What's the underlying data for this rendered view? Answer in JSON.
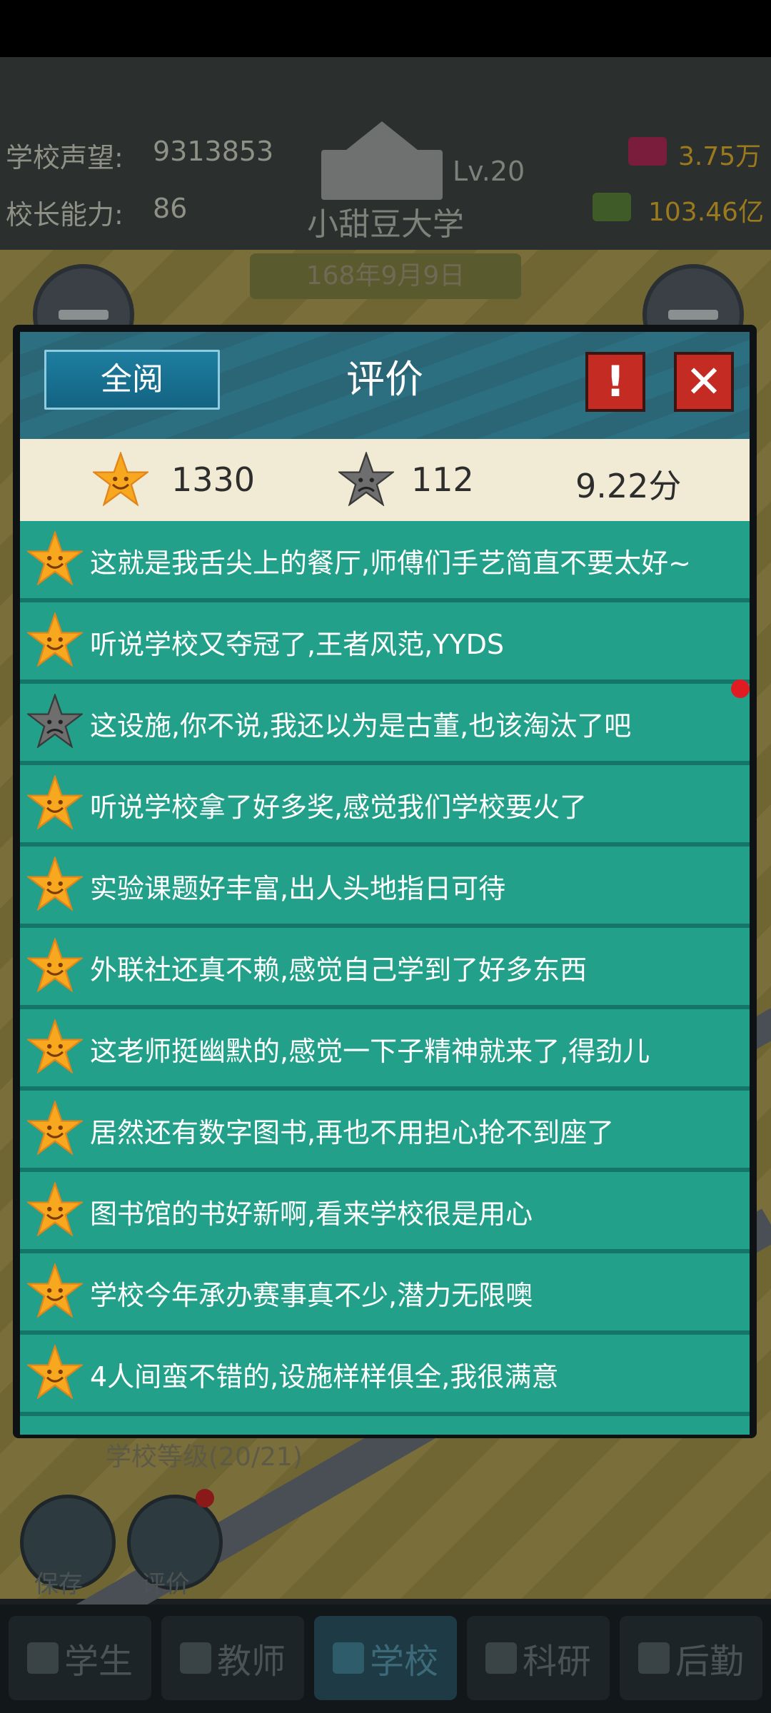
{
  "game": {
    "reputation_label": "学校声望:",
    "reputation_value": "9313853",
    "ability_label": "校长能力:",
    "ability_value": "86",
    "gems": "3.75万",
    "money": "103.46亿",
    "school_name": "小甜豆大学",
    "school_level": "Lv.20",
    "date": "168年9月9日",
    "level_progress": "学校等级(20/21)",
    "save_label": "保存",
    "review_label": "评价"
  },
  "modal": {
    "title": "评价",
    "all_read_label": "全阅",
    "warn_symbol": "!",
    "close_symbol": "✕",
    "good_count": "1330",
    "bad_count": "112",
    "score": "9.22分"
  },
  "reviews": [
    {
      "type": "good",
      "text": "这就是我舌尖上的餐厅,师傅们手艺简直不要太好~"
    },
    {
      "type": "good",
      "text": "听说学校又夺冠了,王者风范,YYDS"
    },
    {
      "type": "bad",
      "text": "这设施,你不说,我还以为是古董,也该淘汰了吧"
    },
    {
      "type": "good",
      "text": "听说学校拿了好多奖,感觉我们学校要火了"
    },
    {
      "type": "good",
      "text": "实验课题好丰富,出人头地指日可待"
    },
    {
      "type": "good",
      "text": "外联社还真不赖,感觉自己学到了好多东西"
    },
    {
      "type": "good",
      "text": "这老师挺幽默的,感觉一下子精神就来了,得劲儿"
    },
    {
      "type": "good",
      "text": "居然还有数字图书,再也不用担心抢不到座了"
    },
    {
      "type": "good",
      "text": "图书馆的书好新啊,看来学校很是用心"
    },
    {
      "type": "good",
      "text": "学校今年承办赛事真不少,潜力无限噢"
    },
    {
      "type": "good",
      "text": "4人间蛮不错的,设施样样俱全,我很满意"
    }
  ],
  "tabs": [
    {
      "label": "学生"
    },
    {
      "label": "教师"
    },
    {
      "label": "学校"
    },
    {
      "label": "科研"
    },
    {
      "label": "后勤"
    }
  ],
  "colors": {
    "list_item": "#22a08a",
    "modal_header": "#2c6f80",
    "stats_bg": "#f1ebd5",
    "accent_red": "#c42b22",
    "good_star": "#f8a81e",
    "bad_star": "#6e6e6e"
  }
}
